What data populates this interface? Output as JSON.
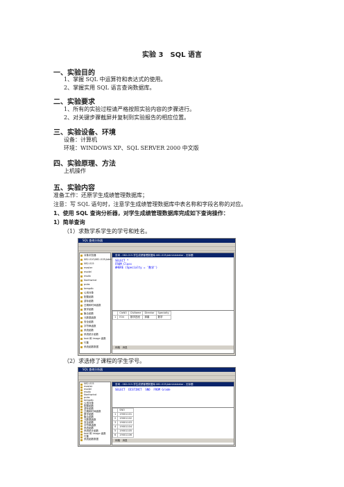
{
  "title": "实验 3　SQL 语言",
  "s1": {
    "heading": "一、实验目的",
    "items": [
      "1、掌握 SQL 中运算符和表达式的使用。",
      "2、掌握实用 SQL 语言查询数据库。"
    ]
  },
  "s2": {
    "heading": "二、实验要求",
    "items": [
      "1、所有的实验过程请严格按照实验内容的步骤进行。",
      "2、对关键步骤截屏并复制到实验报告的相应位置。"
    ]
  },
  "s3": {
    "heading": "三、实验设备、环境",
    "items": [
      "设备：计算机",
      "环境：WINDOWS XP、SQL SERVER 2000 中文版"
    ]
  },
  "s4": {
    "heading": "四、实验原理、方法",
    "items": [
      "上机操作"
    ]
  },
  "s5": {
    "heading": "五、实验内容",
    "prep": "准备工作：还原学生成绩管理数据库；",
    "note": "注意：写 SQL 语句时，注意学生成绩管理数据库中表名称和字段名称的对应。",
    "step": "1、使用 SQL 查询分析器，对学生成绩管理数据库完成如下查询操作：",
    "sub": "1）简单查询",
    "q1": "（1）求数学系学生的学号和姓名。",
    "q2": "（2）求选修了课程的学生学号。"
  },
  "shot1": {
    "app_title": "SQL 查询分析器",
    "tree_header": "对象浏览器",
    "server": "082-010\\082-015\\Adm",
    "tree": [
      "082-015",
      "master",
      "model",
      "msdb",
      "Northwind",
      "pubs",
      "tempdb",
      "公用对象",
      "配置函数",
      "游标函数",
      "日期和时间函数",
      "数学函数",
      "聚合函数",
      "元数据函数",
      "安全函数",
      "字符串函数",
      "系统函数",
      "系统统计函数",
      "text 和 image 函数",
      "行集",
      "系统函数数据"
    ],
    "query_title": "查询 - 082-015.学生成绩管理数据库.082-015\\Administrator - 无标题",
    "sql": "SELECT *\nFROM Class\nWHERE (Specialty = '数学')",
    "columns": [
      "ClsNO",
      "ClsName",
      "Director",
      "Specialty"
    ],
    "rows": [
      [
        "1",
        "E04",
        "数学四班",
        "邱鼎",
        "数学"
      ]
    ],
    "tabs": [
      "网格",
      "消息"
    ]
  },
  "shot2": {
    "query_title": "查询 - 082-015.学生成绩管理数据库.082-015\\Administrator - 无标题",
    "sql": "SELECT  DISTINCT  SNO  FROM Grade",
    "columns": [
      "SNO"
    ],
    "rows": [
      [
        "1",
        "19001101"
      ],
      [
        "2",
        "19001102"
      ],
      [
        "3",
        "19001103"
      ],
      [
        "4",
        "19001104"
      ],
      [
        "5",
        "19001105"
      ],
      [
        "6",
        "19001106"
      ]
    ],
    "tree": [
      "082-015",
      "master",
      "model",
      "msdb",
      "Northwind",
      "pubs",
      "tempdb",
      "公用对象",
      "配置函数",
      "游标函数",
      "日期和时间函数",
      "数学函数",
      "聚合函数",
      "元数据函数",
      "安全函数",
      "字符串函数",
      "系统函数",
      "系统统计函数",
      "text 和 image 函数",
      "行集",
      "系统函数数据"
    ],
    "tabs": [
      "网格",
      "消息"
    ]
  }
}
